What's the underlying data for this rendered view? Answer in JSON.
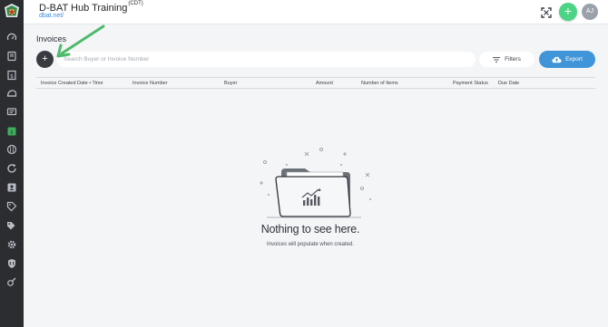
{
  "header": {
    "app_title": "D-BAT Hub Training",
    "timezone": "(CDT)",
    "app_link": "dbat.net/",
    "avatar_initials": "AJ",
    "add_label": "+"
  },
  "sidebar": {
    "items": [
      {
        "icon": "speedometer-icon"
      },
      {
        "icon": "book-icon"
      },
      {
        "icon": "dollar-receipt-icon"
      },
      {
        "icon": "cap-icon"
      },
      {
        "icon": "chat-icon"
      },
      {
        "icon": "invoice-icon"
      },
      {
        "icon": "baseball-icon"
      },
      {
        "icon": "refresh-icon"
      },
      {
        "icon": "contacts-icon"
      },
      {
        "icon": "tag-icon"
      },
      {
        "icon": "tags-icon"
      },
      {
        "icon": "gear-icon"
      },
      {
        "icon": "shield-icon"
      },
      {
        "icon": "tools-icon"
      }
    ]
  },
  "main": {
    "page_title": "Invoices",
    "add_button_label": "+",
    "search_placeholder": "Search Buyer or Invoice Number",
    "filters_label": "Filters",
    "export_label": "Export",
    "columns": [
      "Invoice Created Date • Time",
      "Invoice Number",
      "Buyer",
      "Amount",
      "Number of Items",
      "Payment Status",
      "Due Date"
    ],
    "empty_title": "Nothing to see here.",
    "empty_subtitle": "Invoices will populate when created."
  },
  "colors": {
    "sidebar_bg": "#2b2d31",
    "accent_green": "#4cd486",
    "export_blue": "#3f95d8",
    "arrow_green": "#4dbb6a",
    "page_bg": "#f4f5f7"
  }
}
